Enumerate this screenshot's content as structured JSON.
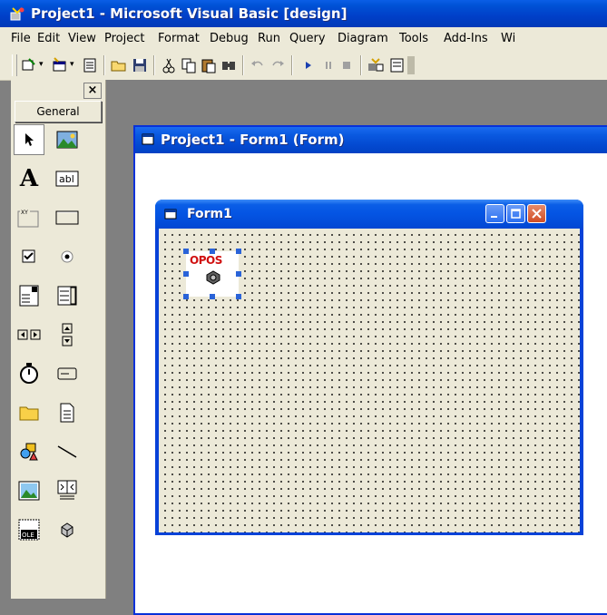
{
  "window": {
    "title": "Project1 - Microsoft Visual Basic [design]"
  },
  "menu": {
    "items": [
      {
        "label": "File"
      },
      {
        "label": "Edit"
      },
      {
        "label": "View"
      },
      {
        "label": "Project"
      },
      {
        "label": "Format"
      },
      {
        "label": "Debug"
      },
      {
        "label": "Run"
      },
      {
        "label": "Query"
      },
      {
        "label": "Diagram"
      },
      {
        "label": "Tools"
      },
      {
        "label": "Add-Ins"
      },
      {
        "label": "Wi"
      }
    ]
  },
  "toolbar": {
    "buttons": [
      "add-project-icon",
      "add-form-icon",
      "menu-editor-icon",
      "open-project-icon",
      "save-project-icon",
      "cut-icon",
      "copy-icon",
      "paste-icon",
      "find-icon",
      "undo-icon",
      "redo-icon",
      "start-icon",
      "break-icon",
      "end-icon",
      "project-explorer-icon",
      "properties-window-icon"
    ]
  },
  "toolbox": {
    "close_label": "×",
    "tab_label": "General",
    "tools": [
      "pointer",
      "picturebox",
      "label",
      "textbox",
      "frame",
      "commandbutton",
      "checkbox",
      "optionbutton",
      "combobox",
      "listbox",
      "hscrollbar",
      "vscrollbar",
      "timer",
      "drivelistbox",
      "dirlistbox",
      "filelistbox",
      "shape",
      "line",
      "image",
      "data",
      "ole",
      "custom"
    ]
  },
  "designer": {
    "title": "Project1 - Form1 (Form)"
  },
  "form": {
    "title": "Form1"
  },
  "control": {
    "label": "OPOS"
  },
  "colors": {
    "xp_blue": "#0842d8",
    "dialog_face": "#ece9d8",
    "close_red": "#d14d24"
  }
}
